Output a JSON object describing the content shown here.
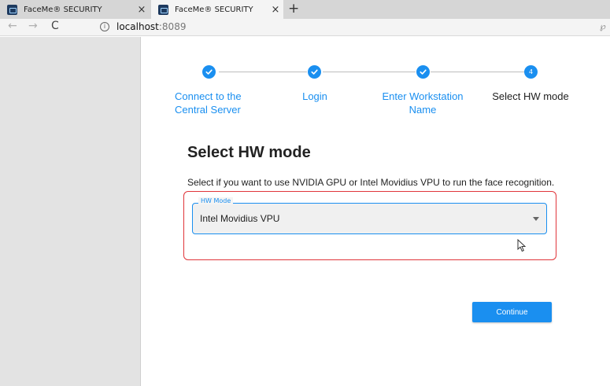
{
  "browser": {
    "tabs": [
      {
        "title": "FaceMe® SECURITY",
        "close": "×"
      },
      {
        "title": "FaceMe® SECURITY",
        "close": "×"
      }
    ],
    "new_tab": "+",
    "nav": {
      "back": "←",
      "forward": "→",
      "reload": "C"
    },
    "info_icon": "i",
    "url_host": "localhost",
    "url_port": ":8089",
    "icons": [
      "favicon-icon",
      "back-arrow-icon",
      "forward-arrow-icon",
      "reload-icon",
      "info-icon",
      "extension-icon"
    ]
  },
  "stepper": {
    "steps": [
      {
        "label_line1": "Connect to the",
        "label_line2": "Central Server",
        "state": "done"
      },
      {
        "label_line1": "Login",
        "label_line2": "",
        "state": "done"
      },
      {
        "label_line1": "Enter Workstation",
        "label_line2": "Name",
        "state": "done"
      },
      {
        "label_line1": "Select HW mode",
        "label_line2": "",
        "state": "current",
        "number": "4"
      }
    ]
  },
  "content": {
    "title": "Select HW mode",
    "description": "Select if you want to use NVIDIA GPU or Intel Movidius VPU to run the face recognition.",
    "hw_select": {
      "legend": "HW Mode",
      "selected_value": "Intel Movidius VPU"
    },
    "continue_label": "Continue"
  },
  "colors": {
    "accent": "#1a8ff0",
    "highlight_border": "#e0353a",
    "sidebar_bg": "#e3e3e3"
  }
}
